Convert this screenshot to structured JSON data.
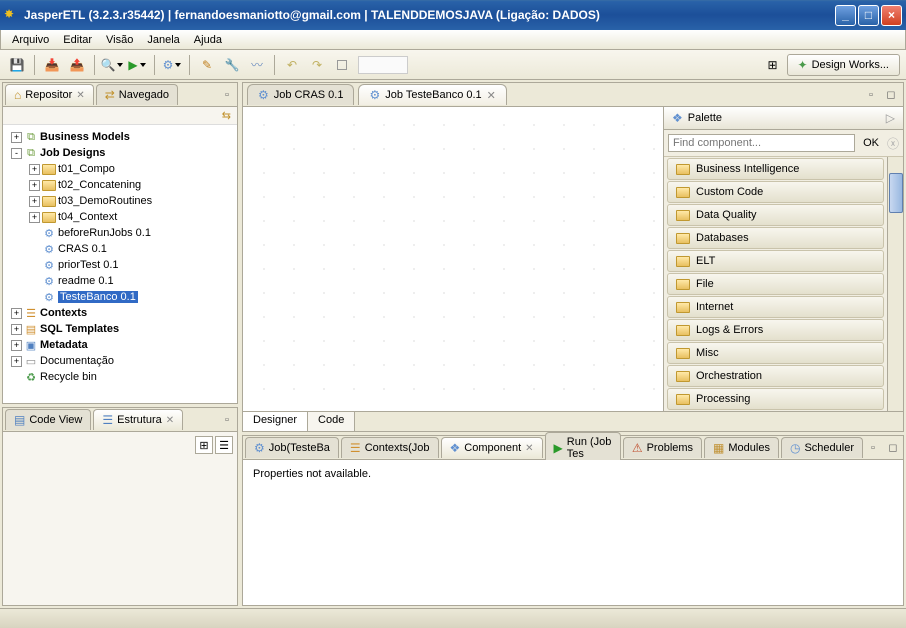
{
  "window": {
    "title": "JasperETL (3.2.3.r35442) | fernandoesmaniotto@gmail.com | TALENDDEMOSJAVA (Ligação: DADOS)"
  },
  "menu": {
    "items": [
      "Arquivo",
      "Editar",
      "Visão",
      "Janela",
      "Ajuda"
    ]
  },
  "toolbar_right": {
    "design": "Design Works..."
  },
  "left_top": {
    "tab1": "Repositor",
    "tab2": "Navegado",
    "nodes": [
      {
        "label": "Business Models",
        "bold": true
      },
      {
        "label": "Job Designs",
        "bold": true
      },
      {
        "label": "t01_Compo"
      },
      {
        "label": "t02_Concatening"
      },
      {
        "label": "t03_DemoRoutines"
      },
      {
        "label": "t04_Context"
      },
      {
        "label": "beforeRunJobs 0.1"
      },
      {
        "label": "CRAS 0.1"
      },
      {
        "label": "priorTest 0.1"
      },
      {
        "label": "readme 0.1"
      },
      {
        "label": "TesteBanco 0.1",
        "selected": true
      },
      {
        "label": "Contexts",
        "bold": true
      },
      {
        "label": "SQL Templates",
        "bold": true
      },
      {
        "label": "Metadata",
        "bold": true
      },
      {
        "label": "Documentação"
      },
      {
        "label": "Recycle bin"
      }
    ]
  },
  "left_bottom": {
    "tab1": "Code View",
    "tab2": "Estrutura"
  },
  "editor": {
    "tabs": [
      {
        "label": "Job CRAS 0.1"
      },
      {
        "label": "Job TesteBanco 0.1",
        "active": true
      }
    ],
    "bottom": {
      "designer": "Designer",
      "code": "Code"
    }
  },
  "palette": {
    "title": "Palette",
    "search_placeholder": "Find component...",
    "ok": "OK",
    "items": [
      "Business Intelligence",
      "Custom Code",
      "Data Quality",
      "Databases",
      "ELT",
      "File",
      "Internet",
      "Logs & Errors",
      "Misc",
      "Orchestration",
      "Processing"
    ]
  },
  "bottom": {
    "tabs": [
      "Job(TesteBa",
      "Contexts(Job",
      "Component",
      "Run (Job Tes",
      "Problems",
      "Modules",
      "Scheduler"
    ],
    "active_index": 2,
    "message": "Properties not available."
  }
}
